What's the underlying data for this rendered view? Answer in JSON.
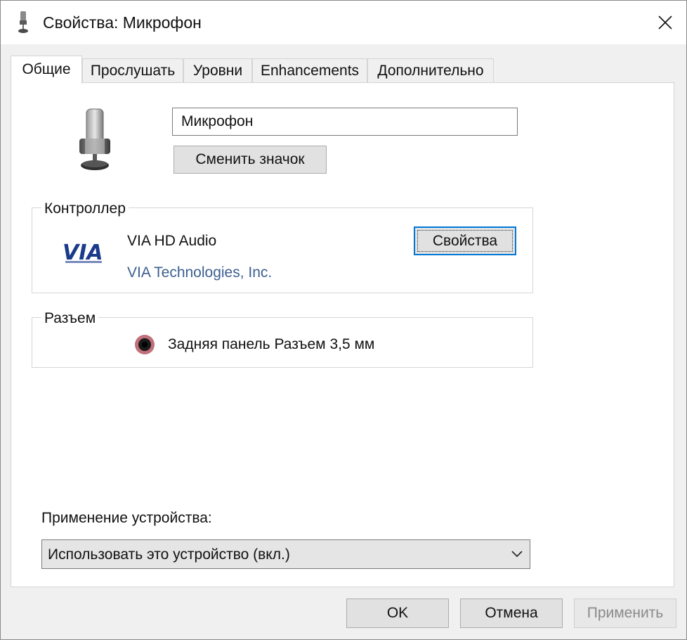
{
  "window": {
    "title": "Свойства: Микрофон",
    "close_icon": "close-icon"
  },
  "tabs": [
    {
      "label": "Общие",
      "active": true
    },
    {
      "label": "Прослушать",
      "active": false
    },
    {
      "label": "Уровни",
      "active": false
    },
    {
      "label": "Enhancements",
      "active": false
    },
    {
      "label": "Дополнительно",
      "active": false
    }
  ],
  "general": {
    "device_icon": "microphone-icon",
    "device_name": "Микрофон",
    "change_icon_label": "Сменить значок"
  },
  "controller": {
    "group_label": "Контроллер",
    "logo_text": "VIA",
    "name": "VIA HD Audio",
    "vendor": "VIA Technologies, Inc.",
    "properties_label": "Свойства"
  },
  "jack": {
    "group_label": "Разъем",
    "icon": "audio-jack-icon",
    "description": "Задняя панель Разъем 3,5 мм",
    "jack_color": "#c0707a"
  },
  "usage": {
    "label": "Применение устройства:",
    "selected": "Использовать это устройство (вкл.)"
  },
  "footer": {
    "ok_label": "OK",
    "cancel_label": "Отмена",
    "apply_label": "Применить"
  }
}
